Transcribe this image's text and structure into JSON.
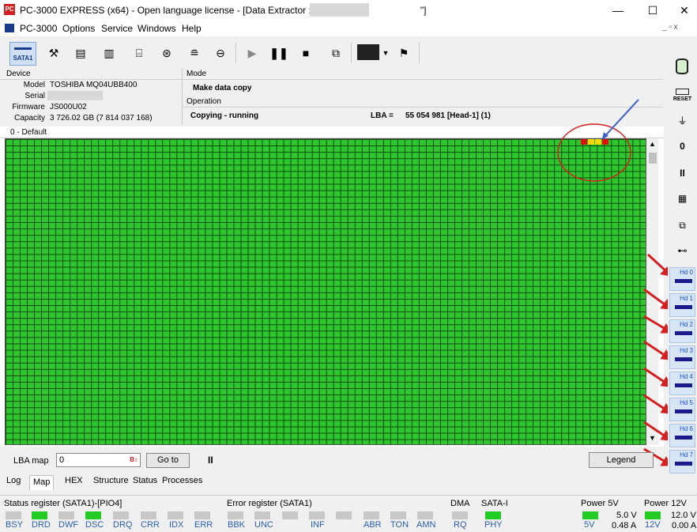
{
  "window": {
    "title": "PC-3000 EXPRESS (x64) - Open language license - [Data Extractor : Task - \"D:\\",
    "title_end": "\"]",
    "logo_text": "PC",
    "minimize": "—",
    "maximize": "☐",
    "close": "✕"
  },
  "menu": {
    "app": "PC-3000",
    "items": [
      "Options",
      "Service",
      "Windows",
      "Help"
    ],
    "mdi_controls": "_ ▫ x"
  },
  "toolbar": {
    "sata_label": "SATA1"
  },
  "device": {
    "header": "Device",
    "model_label": "Model",
    "model_value": "TOSHIBA MQ04UBB400",
    "serial_label": "Serial",
    "firmware_label": "Firmware",
    "firmware_value": "JS000U02",
    "capacity_label": "Capacity",
    "capacity_value": "3 726.02 GB (7 814 037 168)"
  },
  "mode": {
    "header": "Mode",
    "value": "Make data copy",
    "operation_header": "Operation",
    "operation_value": "Copying - running",
    "lba_label": "LBA =",
    "lba_value": "55 054 981  [Head-1] (1)"
  },
  "map": {
    "section_label": "0 - Default",
    "lba_map_label": "LBA map",
    "lba_input": "0",
    "goto_label": "Go to",
    "legend_label": "Legend",
    "pause_label": "II"
  },
  "tabs": [
    "Log",
    "Map",
    "HEX",
    "Structure",
    "Status",
    "Processes"
  ],
  "active_tab": "Map",
  "status": {
    "status_register_title": "Status register (SATA1)-[PIO4]",
    "status_leds": [
      "BSY",
      "DRD",
      "DWF",
      "DSC",
      "DRQ",
      "CRR",
      "IDX",
      "ERR"
    ],
    "error_register_title": "Error register (SATA1)",
    "error_leds": [
      "BBK",
      "UNC",
      "",
      "INF",
      "",
      "ABR",
      "TON",
      "AMN"
    ],
    "dma_title": "DMA",
    "dma_led": "RQ",
    "sata_title": "SATA-I",
    "sata_led": "PHY",
    "power5_title": "Power 5V",
    "power5_led": "5V",
    "power5_voltage": "5.0 V",
    "power5_current": "0.48 A",
    "power12_title": "Power 12V",
    "power12_led": "12V",
    "power12_voltage": "12.0 V",
    "power12_current": "0.00 A"
  },
  "right_toolbar": {
    "reset_label": "RESET",
    "heads": [
      "Hd 0",
      "Hd 1",
      "Hd 2",
      "Hd 3",
      "Hd 4",
      "Hd 5",
      "Hd 6",
      "Hd 7"
    ]
  },
  "colors": {
    "good_block": "#2ec52e",
    "bad_block": "#e01010",
    "slow_block": "#f5d800",
    "annotation_red": "#d42020",
    "annotation_blue": "#3a5fcd"
  }
}
